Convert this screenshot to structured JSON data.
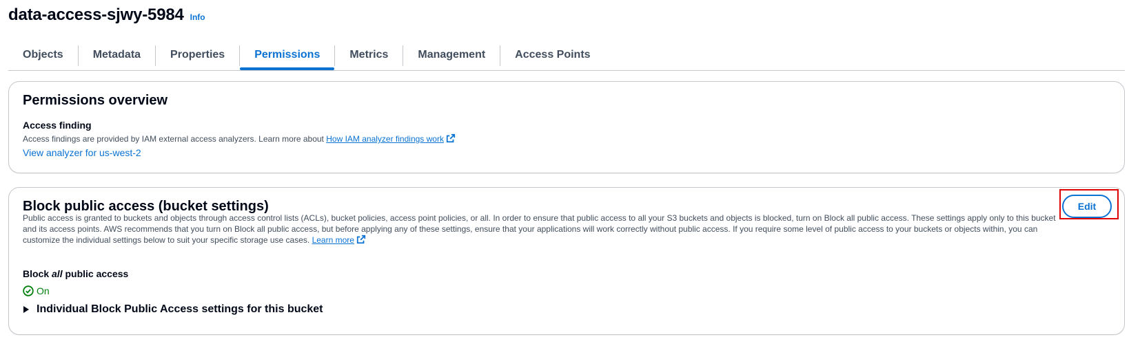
{
  "header": {
    "title": "data-access-sjwy-5984",
    "info_label": "Info"
  },
  "tabs": [
    {
      "label": "Objects",
      "active": false
    },
    {
      "label": "Metadata",
      "active": false
    },
    {
      "label": "Properties",
      "active": false
    },
    {
      "label": "Permissions",
      "active": true
    },
    {
      "label": "Metrics",
      "active": false
    },
    {
      "label": "Management",
      "active": false
    },
    {
      "label": "Access Points",
      "active": false
    }
  ],
  "permissions_overview": {
    "heading": "Permissions overview",
    "access_finding_label": "Access finding",
    "description_prefix": "Access findings are provided by IAM external access analyzers. Learn more about ",
    "description_link": "How IAM analyzer findings work",
    "analyzer_link": "View analyzer for us-west-2"
  },
  "block_public_access": {
    "heading": "Block public access (bucket settings)",
    "edit_label": "Edit",
    "description": "Public access is granted to buckets and objects through access control lists (ACLs), bucket policies, access point policies, or all. In order to ensure that public access to all your S3 buckets and objects is blocked, turn on Block all public access. These settings apply only to this bucket and its access points. AWS recommends that you turn on Block all public access, but before applying any of these settings, ensure that your applications will work correctly without public access. If you require some level of public access to your buckets or objects within, you can customize the individual settings below to suit your specific storage use cases.",
    "learn_more": "Learn more",
    "block_all_prefix": "Block ",
    "block_all_emph": "all",
    "block_all_suffix": " public access",
    "status": "On",
    "expander_label": "Individual Block Public Access settings for this bucket"
  },
  "colors": {
    "accent": "#0972d3",
    "success": "#037f0c",
    "highlight": "#e00000"
  }
}
